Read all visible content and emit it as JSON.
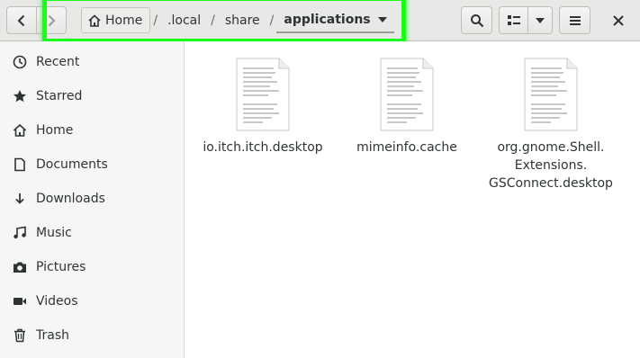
{
  "header": {
    "back_icon": "chevron-left-icon",
    "forward_icon": "chevron-right-icon",
    "breadcrumbs": {
      "home": "Home",
      "local": ".local",
      "share": "share",
      "applications": "applications",
      "separator": "/"
    },
    "actions": [
      "search-icon",
      "view-list-icon",
      "dropdown-icon",
      "hamburger-menu-icon",
      "close-icon"
    ]
  },
  "highlight": {
    "color": "#19ff19"
  },
  "sidebar": {
    "items": [
      {
        "label": "Recent",
        "icon": "clock-icon"
      },
      {
        "label": "Starred",
        "icon": "star-icon"
      },
      {
        "label": "Home",
        "icon": "home-icon"
      },
      {
        "label": "Documents",
        "icon": "document-icon"
      },
      {
        "label": "Downloads",
        "icon": "download-icon"
      },
      {
        "label": "Music",
        "icon": "music-icon"
      },
      {
        "label": "Pictures",
        "icon": "camera-icon"
      },
      {
        "label": "Videos",
        "icon": "video-icon"
      },
      {
        "label": "Trash",
        "icon": "trash-icon"
      }
    ]
  },
  "files": [
    {
      "name": "io.itch.itch.desktop"
    },
    {
      "name": "mimeinfo.cache"
    },
    {
      "name": "org.gnome.Shell.\nExtensions.\nGSConnect.desktop"
    }
  ]
}
